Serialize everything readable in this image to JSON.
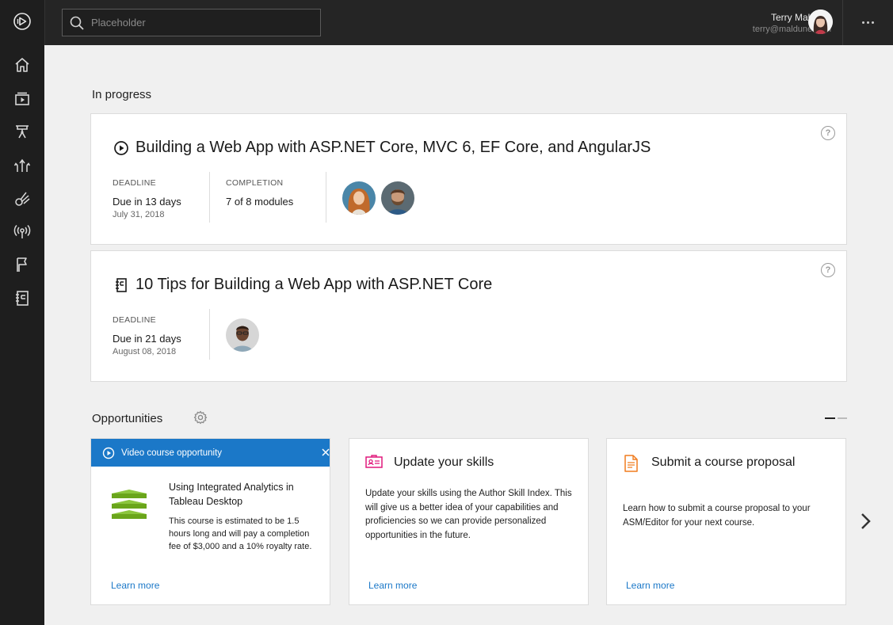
{
  "search": {
    "placeholder": "Placeholder"
  },
  "user": {
    "name": "Terry Maldune",
    "email": "terry@maldune.com"
  },
  "sidebar": {
    "items": [
      {
        "name": "home"
      },
      {
        "name": "library"
      },
      {
        "name": "presentation"
      },
      {
        "name": "paths"
      },
      {
        "name": "skills"
      },
      {
        "name": "broadcast"
      },
      {
        "name": "bookmark"
      },
      {
        "name": "notebook"
      }
    ]
  },
  "in_progress": {
    "title": "In progress",
    "courses": [
      {
        "icon": "play-circle-icon",
        "title": "Building a Web App with ASP.NET Core, MVC 6, EF Core, and AngularJS",
        "deadline_label": "DEADLINE",
        "deadline_value": "Due in 13 days",
        "deadline_date": "July 31, 2018",
        "completion_label": "COMPLETION",
        "completion_value": "7 of 8 modules"
      },
      {
        "icon": "notebook-icon",
        "title": "10 Tips for Building a Web App with ASP.NET Core",
        "deadline_label": "DEADLINE",
        "deadline_value": "Due in 21 days",
        "deadline_date": "August 08, 2018"
      }
    ]
  },
  "opportunities": {
    "title": "Opportunities",
    "video_card": {
      "banner": "Video course opportunity",
      "title": "Using Integrated Analytics in Tableau Desktop",
      "body": "This course is estimated to be 1.5 hours long and will pay a completion fee of $3,000 and a 10% royalty rate.",
      "link": "Learn more"
    },
    "skills_card": {
      "title": "Update your skills",
      "body": "Update your skills using the Author Skill Index. This will give us a better idea of your capabilities and proficiencies so we can provide personalized opportunities in the future.",
      "link": "Learn more"
    },
    "proposal_card": {
      "title": "Submit a course proposal",
      "body": "Learn how to submit a course proposal to your ASM/Editor for your next course.",
      "link": "Learn more"
    }
  },
  "colors": {
    "accent": "#1b78c8",
    "skills_icon": "#e0187c",
    "proposal_icon": "#f07c1e",
    "tableau_green": "#7ab51d"
  }
}
